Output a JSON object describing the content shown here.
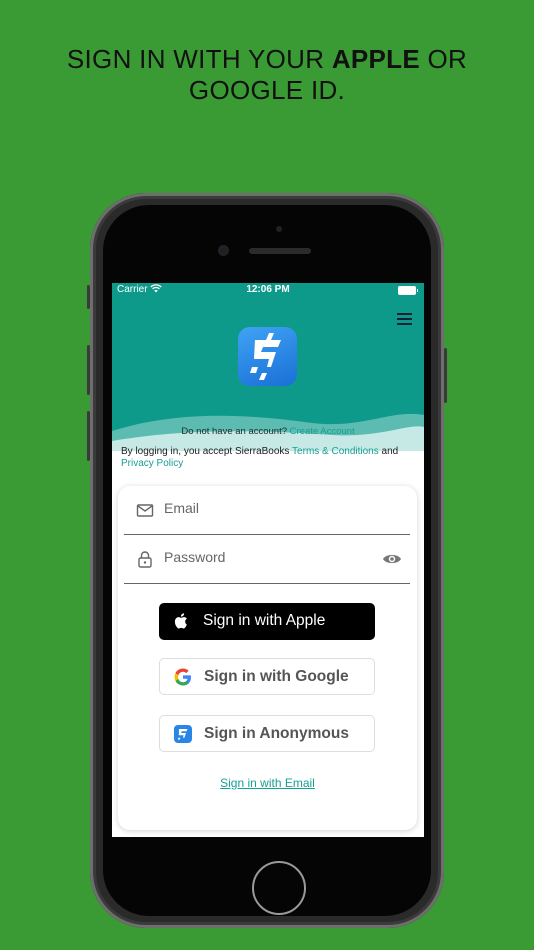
{
  "headline": {
    "prefix": "SIGN IN WITH YOUR ",
    "bold": "APPLE",
    "suffix": " OR",
    "line2": "GOOGLE ID."
  },
  "status_bar": {
    "carrier": "Carrier",
    "time": "12:06 PM"
  },
  "colors": {
    "background": "#3a9b34",
    "teal": "#0e9a8a",
    "link": "#16a093"
  },
  "login": {
    "no_account_text": "Do not have an account?",
    "create_account_link": "Create Account",
    "terms_prefix": "By logging in, you accept SierraBooks",
    "terms_link": "Terms & Conditions",
    "terms_and": "and",
    "privacy_link": "Privacy Policy",
    "email_placeholder": "Email",
    "password_placeholder": "Password",
    "apple_button": "Sign in with Apple",
    "google_button": "Sign in with Google",
    "anonymous_button": "Sign in Anonymous",
    "email_signin_link": "Sign in with Email"
  },
  "icons": [
    "menu-icon",
    "app-logo",
    "mail-icon",
    "lock-icon",
    "eye-icon",
    "apple-icon",
    "google-icon",
    "sierrabooks-icon",
    "wifi-icon",
    "battery-icon"
  ]
}
